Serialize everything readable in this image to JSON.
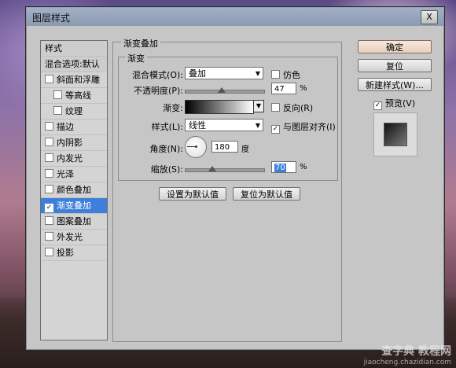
{
  "window": {
    "title": "图层样式",
    "close_label": "X"
  },
  "sidebar": {
    "header": "样式",
    "blend_options": "混合选项:默认",
    "items": [
      {
        "label": "斜面和浮雕",
        "checked": false,
        "sub": false
      },
      {
        "label": "等高线",
        "checked": false,
        "sub": true
      },
      {
        "label": "纹理",
        "checked": false,
        "sub": true
      },
      {
        "label": "描边",
        "checked": false,
        "sub": false
      },
      {
        "label": "内阴影",
        "checked": false,
        "sub": false
      },
      {
        "label": "内发光",
        "checked": false,
        "sub": false
      },
      {
        "label": "光泽",
        "checked": false,
        "sub": false
      },
      {
        "label": "颜色叠加",
        "checked": false,
        "sub": false
      },
      {
        "label": "渐变叠加",
        "checked": true,
        "sub": false
      },
      {
        "label": "图案叠加",
        "checked": false,
        "sub": false
      },
      {
        "label": "外发光",
        "checked": false,
        "sub": false
      },
      {
        "label": "投影",
        "checked": false,
        "sub": false
      }
    ]
  },
  "main": {
    "group_title": "渐变叠加",
    "sub_title": "渐变",
    "blend_mode_label": "混合模式(O):",
    "blend_mode_value": "叠加",
    "dither_label": "仿色",
    "opacity_label": "不透明度(P):",
    "opacity_value": "47",
    "opacity_percent": 47,
    "percent_unit": "%",
    "gradient_label": "渐变:",
    "reverse_label": "反向(R)",
    "style_label": "样式(L):",
    "style_value": "线性",
    "align_label": "与图层对齐(I)",
    "angle_label": "角度(N):",
    "angle_value": "180",
    "angle_unit": "度",
    "scale_label": "缩放(S):",
    "scale_value": "70",
    "scale_percent": 70,
    "set_default_btn": "设置为默认值",
    "reset_default_btn": "复位为默认值"
  },
  "right": {
    "ok_btn": "确定",
    "reset_btn": "复位",
    "new_style_btn": "新建样式(W)...",
    "preview_label": "预览(V)"
  },
  "watermark": {
    "big": "查字典 教程网",
    "small": "jiaocheng.chazidian.com"
  },
  "colors": {
    "selected": "#3e7fd9",
    "dialog_bg": "#c6c6c6"
  },
  "icons": {
    "check": "✓",
    "dropdown": "▼",
    "close": "close-icon"
  }
}
